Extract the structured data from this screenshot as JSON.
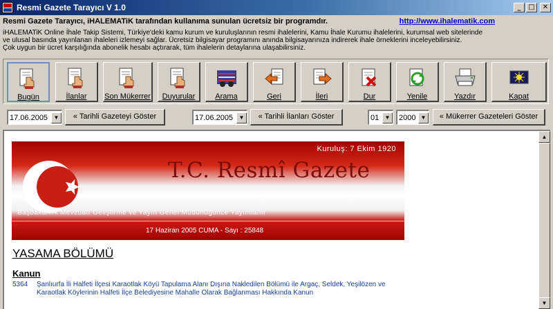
{
  "window": {
    "title": "Resmi Gazete Tarayıcı V 1.0"
  },
  "info": {
    "headline": "Resmi Gazete Tarayıcı, iHALEMATiK tarafından kullanıma sunulan ücretsiz bir programdır.",
    "link": "http://www.ihalematik.com",
    "description": [
      "iHALEMATiK Online İhale Takip Sistemi, Türkiye'deki kamu kurum ve kuruluşlarının resmi ihalelerini, Kamu İhale Kurumu ihalelerini, kurumsal web sitelerinde",
      "ve ulusal basında yayınlanan ihaleleri izlemeyi sağlar. Ücretsiz bilgisayar programını anında bilgisayarınıza indirerek ihale örneklerini inceleyebilirsiniz.",
      "Çok uygun bir ücret karşılığında abonelik hesabı açtırarak, tüm ihalelerin detaylarına ulaşabilirsiniz."
    ]
  },
  "toolbar": [
    {
      "label": "Bugün",
      "icon": "hand-pointer-icon"
    },
    {
      "label": "İlanlar",
      "icon": "hand-pointer-icon"
    },
    {
      "label": "Son Mükerrer",
      "icon": "hand-pointer-icon"
    },
    {
      "label": "Duyurular",
      "icon": "hand-pointer-icon"
    },
    {
      "label": "Arama",
      "icon": "search-glasses-icon"
    },
    {
      "label": "Geri",
      "icon": "back-arrow-icon"
    },
    {
      "label": "İleri",
      "icon": "forward-arrow-icon"
    },
    {
      "label": "Dur",
      "icon": "stop-icon"
    },
    {
      "label": "Yenile",
      "icon": "refresh-icon"
    },
    {
      "label": "Yazdır",
      "icon": "printer-icon"
    },
    {
      "label": "Kapat",
      "icon": "close-window-icon"
    }
  ],
  "controls": {
    "date1": "17.06.2005",
    "btn_gazete": "« Tarihli Gazeteyi Göster",
    "date2": "17.06.2005",
    "btn_ilanlar": "« Tarihli İlanları Göster",
    "month": "01",
    "year": "2000",
    "btn_mukerrer": "« Mükerrer Gazeteleri Göster"
  },
  "page": {
    "banner_founded": "Kuruluş: 7 Ekim 1920",
    "banner_title": "T.C. Resmî Gazete",
    "banner_subtitle": "Başbakanlık Mevzuatı Geliştirme ve Yayın Genel Müdürlüğünce Yayımlanır",
    "banner_date": "17 Haziran 2005 CUMA - Sayı : 25848",
    "section_title": "YASAMA BÖLÜMÜ",
    "law_heading": "Kanun",
    "law_number": "5364",
    "law_text": "Şanlıurfa İli Halfeti İlçesi Karaotlak Köyü Tapulama Alanı Dışına  Nakledilen Bölümü ile Argaç, Seldek, Yeşilözen ve Karaotlak Köylerinin  Halfeti İlçe Belediyesine Mahalle Olarak Bağlanması Hakkında Kanun"
  },
  "colors": {
    "titlebar": "#0a246a",
    "banner_red": "#c81e16",
    "link": "#0000cc"
  }
}
